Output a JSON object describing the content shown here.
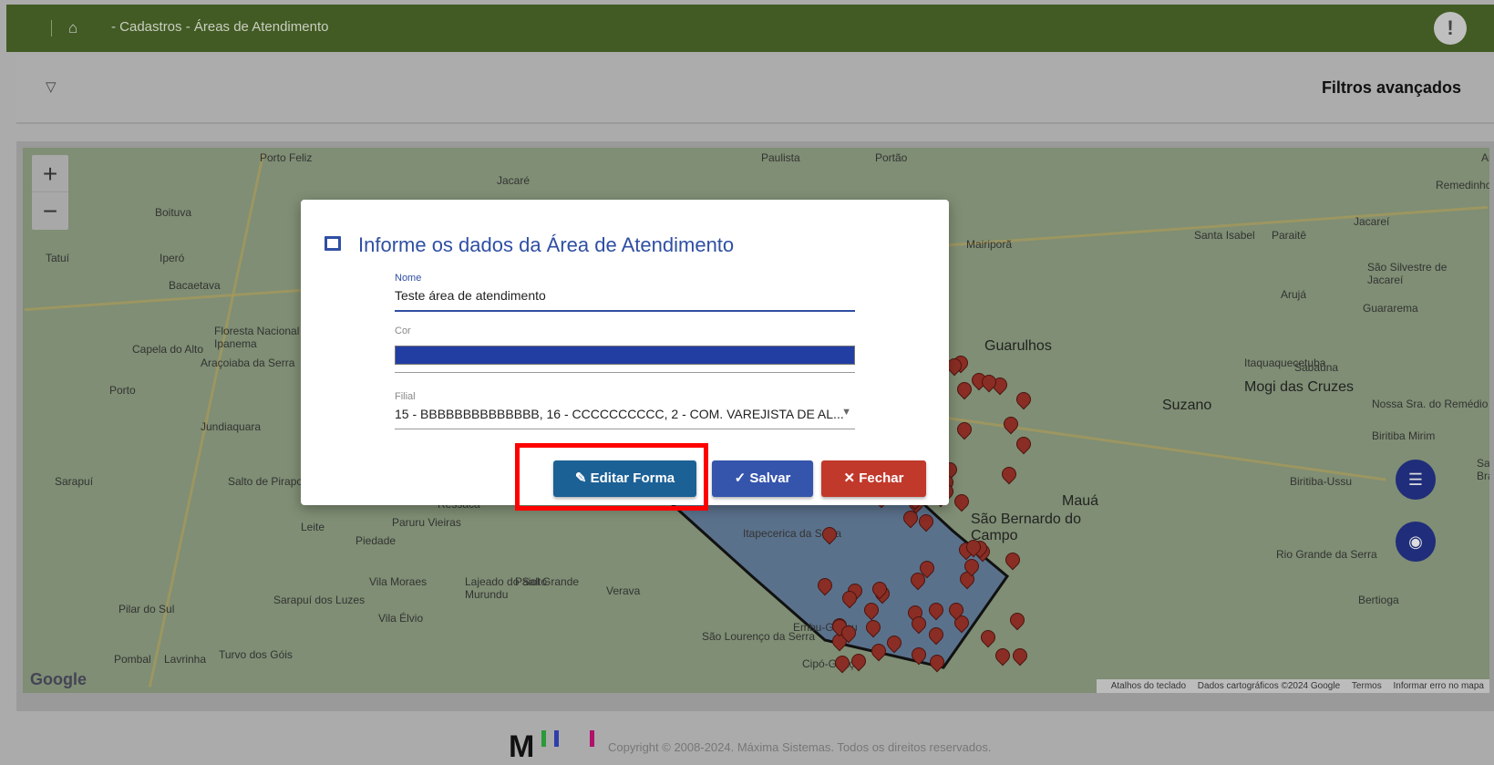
{
  "header": {
    "breadcrumb": "- Cadastros - Áreas de Atendimento",
    "alert_icon": "!"
  },
  "filters": {
    "title": "Filtros avançados"
  },
  "map": {
    "zoom_in": "+",
    "zoom_out": "−",
    "labels": [
      "Porto Feliz",
      "Jacaré",
      "Paulista",
      "Portão",
      "Andrade",
      "Remedinho",
      "Boituva",
      "Tatuí",
      "Iperó",
      "Bacaetava",
      "Capela do Alto",
      "Floresta Nacional de Ipanema",
      "Araçoiaba da Serra",
      "Porto",
      "Jundiaquara",
      "Sarapuí",
      "Salto de Pirapora",
      "Ressaca",
      "Paruru Vieiras",
      "Leite",
      "Piedade",
      "Vila Moraes",
      "Lajeado do Salto Murundu",
      "Paiol Grande",
      "Verava",
      "Pilar do Sul",
      "Sarapuí dos Luzes",
      "Vila Élvio",
      "Pombal",
      "Lavrinha",
      "Turvo dos Góis",
      "Mairiporã",
      "Guarulhos",
      "Santa Isabel",
      "Paraitê",
      "Jacareí",
      "São Silvestre de Jacareí",
      "Arujá",
      "Guararema",
      "Itaquaquecetuba",
      "Suzano",
      "Mogi das Cruzes",
      "Sabaúna",
      "Nossa Sra. do Remédio",
      "Biritiba Mirim",
      "Biritiba-Ussu",
      "Mauá",
      "São Bernardo do Campo",
      "Rio Grande da Serra",
      "Bertioga",
      "Itapecerica da Serra",
      "Embu-Guaçu",
      "São Lourenço da Serra",
      "Cipó-Guaçu",
      "Santa Branca"
    ],
    "attribution": [
      "Atalhos do teclado",
      "Dados cartográficos ©2024 Google",
      "Termos",
      "Informar erro no mapa"
    ],
    "logo": "Google"
  },
  "dialog": {
    "title": "Informe os dados da Área de Atendimento",
    "nome_label": "Nome",
    "nome_value": "Teste área de atendimento",
    "cor_label": "Cor",
    "cor_value": "#233ea3",
    "filial_label": "Filial",
    "filial_value": "15 - BBBBBBBBBBBBBB, 16 - CCCCCCCCCC, 2 - COM. VAREJISTA DE AL...",
    "edit_shape": "Editar Forma",
    "save": "Salvar",
    "close": "Fechar"
  },
  "footer": {
    "logo": "M",
    "copyright": "Copyright © 2008-2024. Máxima Sistemas. Todos os direitos reservados."
  }
}
